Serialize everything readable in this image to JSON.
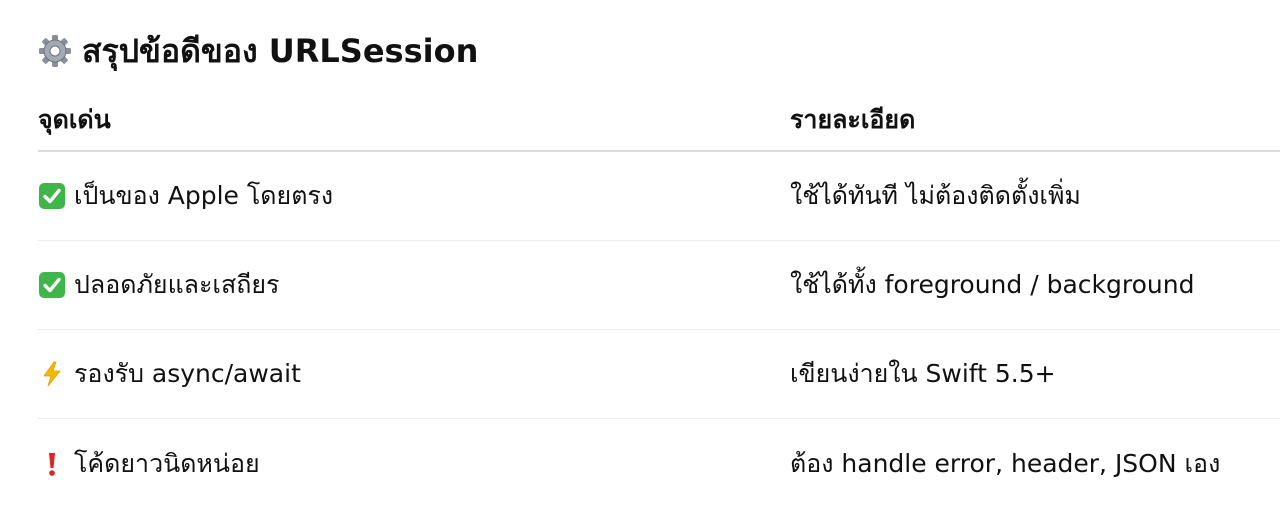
{
  "title": {
    "icon": "gear-icon",
    "text": "สรุปข้อดีของ URLSession"
  },
  "table": {
    "headers": [
      "จุดเด่น",
      "รายละเอียด"
    ],
    "rows": [
      {
        "icon": "check-mark-icon",
        "feature": "เป็นของ Apple โดยตรง",
        "detail": "ใช้ได้ทันที ไม่ต้องติดตั้งเพิ่ม"
      },
      {
        "icon": "check-mark-icon",
        "feature": "ปลอดภัยและเสถียร",
        "detail": "ใช้ได้ทั้ง foreground / background"
      },
      {
        "icon": "lightning-icon",
        "feature": "รองรับ async/await",
        "detail": "เขียนง่ายใน Swift 5.5+"
      },
      {
        "icon": "exclamation-icon",
        "feature": "โค้ดยาวนิดหน่อย",
        "detail": "ต้อง handle error, header, JSON เอง"
      }
    ]
  },
  "colors": {
    "check_green": "#3fb54a",
    "lightning_yellow": "#f5b800",
    "exclamation_red": "#e02424"
  }
}
